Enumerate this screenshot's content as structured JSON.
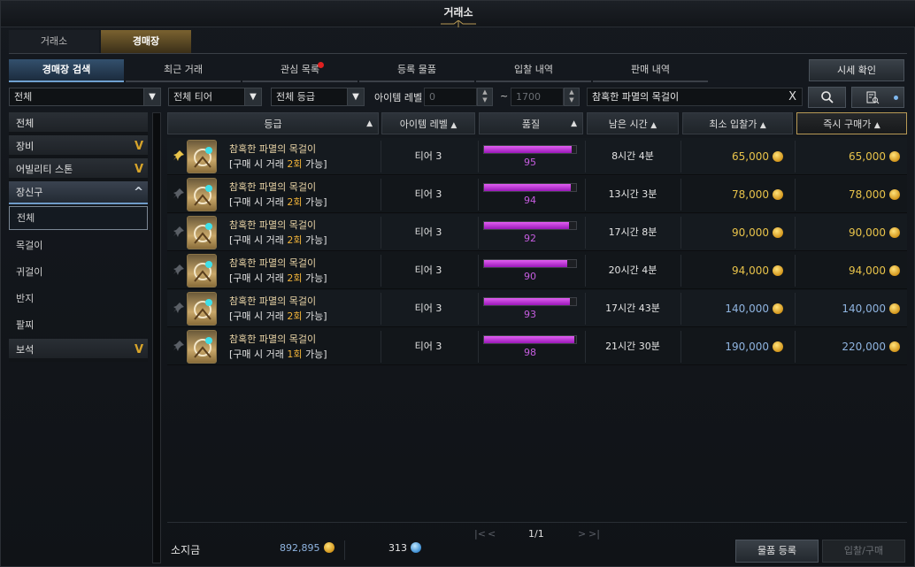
{
  "window": {
    "title": "거래소"
  },
  "top_tabs": [
    {
      "label": "거래소",
      "active": false
    },
    {
      "label": "경매장",
      "active": true
    }
  ],
  "sub_tabs": [
    {
      "label": "경매장 검색",
      "active": true,
      "dot": false
    },
    {
      "label": "최근 거래",
      "active": false,
      "dot": false
    },
    {
      "label": "관심 목록",
      "active": false,
      "dot": true
    },
    {
      "label": "등록 물품",
      "active": false,
      "dot": false
    },
    {
      "label": "입찰 내역",
      "active": false,
      "dot": false
    },
    {
      "label": "판매 내역",
      "active": false,
      "dot": false
    }
  ],
  "market_price_button": "시세 확인",
  "filters": {
    "category": "전체",
    "tier": "전체 티어",
    "grade": "전체 등급",
    "item_level_label": "아이템 레벨",
    "level_min_placeholder": "0",
    "level_sep": "~",
    "level_max_placeholder": "1700",
    "search_value": "참혹한 파멸의 목걸이",
    "clear_label": "X"
  },
  "sidebar": {
    "items": [
      {
        "label": "전체",
        "chevron": ""
      },
      {
        "label": "장비",
        "chevron": "V"
      },
      {
        "label": "어빌리티 스톤",
        "chevron": "V"
      },
      {
        "label": "장신구",
        "chevron": "^"
      }
    ],
    "subitems": [
      "전체",
      "목걸이",
      "귀걸이",
      "반지",
      "팔찌"
    ],
    "after": {
      "label": "보석",
      "chevron": "V"
    }
  },
  "columns": [
    "등급",
    "아이템 레벨",
    "품질",
    "남은 시간",
    "최소 입찰가",
    "즉시 구매가"
  ],
  "rows": [
    {
      "pinned": true,
      "name": "참혹한 파멸의 목걸이",
      "note_pre": "[구매 시 거래 ",
      "note_num": "2회",
      "note_post": " 가능]",
      "tier": "티어 3",
      "quality": 95,
      "time": "8시간 4분",
      "min_bid": "65,000",
      "buyout": "65,000"
    },
    {
      "pinned": false,
      "name": "참혹한 파멸의 목걸이",
      "note_pre": "[구매 시 거래 ",
      "note_num": "2회",
      "note_post": " 가능]",
      "tier": "티어 3",
      "quality": 94,
      "time": "13시간 3분",
      "min_bid": "78,000",
      "buyout": "78,000"
    },
    {
      "pinned": false,
      "name": "참혹한 파멸의 목걸이",
      "note_pre": "[구매 시 거래 ",
      "note_num": "2회",
      "note_post": " 가능]",
      "tier": "티어 3",
      "quality": 92,
      "time": "17시간 8분",
      "min_bid": "90,000",
      "buyout": "90,000"
    },
    {
      "pinned": false,
      "name": "참혹한 파멸의 목걸이",
      "note_pre": "[구매 시 거래 ",
      "note_num": "2회",
      "note_post": " 가능]",
      "tier": "티어 3",
      "quality": 90,
      "time": "20시간 4분",
      "min_bid": "94,000",
      "buyout": "94,000"
    },
    {
      "pinned": false,
      "name": "참혹한 파멸의 목걸이",
      "note_pre": "[구매 시 거래 ",
      "note_num": "2회",
      "note_post": " 가능]",
      "tier": "티어 3",
      "quality": 93,
      "time": "17시간 43분",
      "min_bid": "140,000",
      "buyout": "140,000"
    },
    {
      "pinned": false,
      "name": "참혹한 파멸의 목걸이",
      "note_pre": "[구매 시 거래 ",
      "note_num": "1회",
      "note_post": " 가능]",
      "tier": "티어 3",
      "quality": 98,
      "time": "21시간 30분",
      "min_bid": "190,000",
      "buyout": "220,000"
    }
  ],
  "pagination": {
    "first": "|<",
    "prev": "<",
    "page": "1/1",
    "next": ">",
    "last": ">|"
  },
  "wallet": {
    "gold_label": "소지금",
    "gold": "892,895",
    "crystal": "313"
  },
  "actions": {
    "register": "물품 등록",
    "bid_buy": "입찰/구매"
  },
  "colors": {
    "accent_gold": "#d7a42a",
    "quality_purple": "#c65de0",
    "price_yellow": "#e8c34a",
    "price_blue": "#8fb4e0"
  }
}
